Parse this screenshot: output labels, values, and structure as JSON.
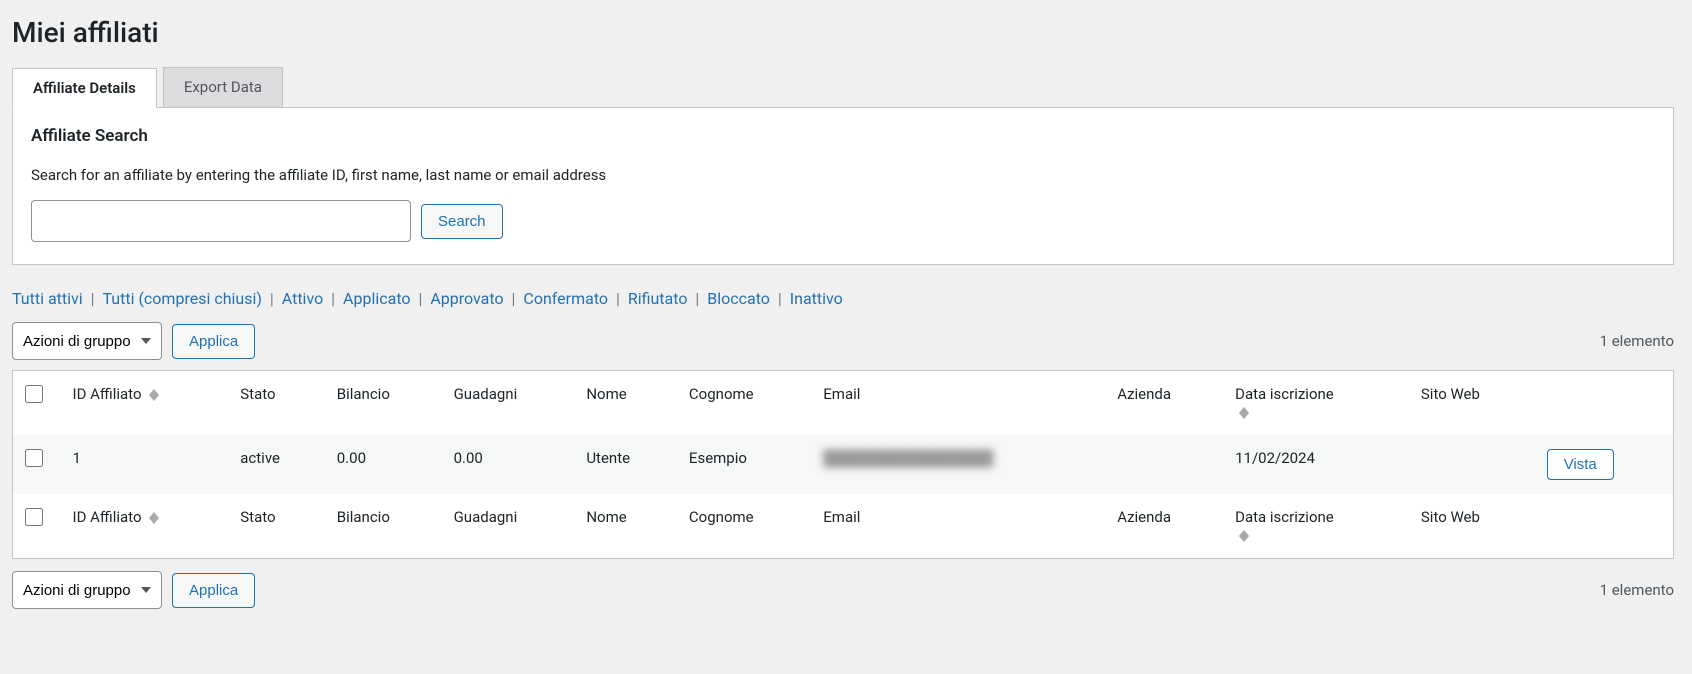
{
  "page": {
    "title": "Miei affiliati"
  },
  "tabs": [
    {
      "label": "Affiliate Details",
      "active": true
    },
    {
      "label": "Export Data",
      "active": false
    }
  ],
  "searchBox": {
    "heading": "Affiliate Search",
    "hint": "Search for an affiliate by entering the affiliate ID, first name, last name or email address",
    "button": "Search"
  },
  "filters": {
    "items": [
      "Tutti attivi",
      "Tutti (compresi chiusi)",
      "Attivo",
      "Applicato",
      "Approvato",
      "Confermato",
      "Rifiutato",
      "Bloccato",
      "Inattivo"
    ]
  },
  "bulk": {
    "selectLabel": "Azioni di gruppo",
    "applyLabel": "Applica"
  },
  "pagination": {
    "countText": "1 elemento"
  },
  "columns": {
    "id": "ID Affiliato",
    "state": "Stato",
    "balance": "Bilancio",
    "earnings": "Guadagni",
    "firstName": "Nome",
    "lastName": "Cognome",
    "email": "Email",
    "company": "Azienda",
    "joinDate": "Data iscrizione",
    "website": "Sito Web"
  },
  "rows": [
    {
      "id": "1",
      "state": "active",
      "balance": "0.00",
      "earnings": "0.00",
      "firstName": "Utente",
      "lastName": "Esempio",
      "email": "████████████████",
      "company": "",
      "joinDate": "11/02/2024",
      "website": "",
      "viewLabel": "Vista"
    }
  ]
}
